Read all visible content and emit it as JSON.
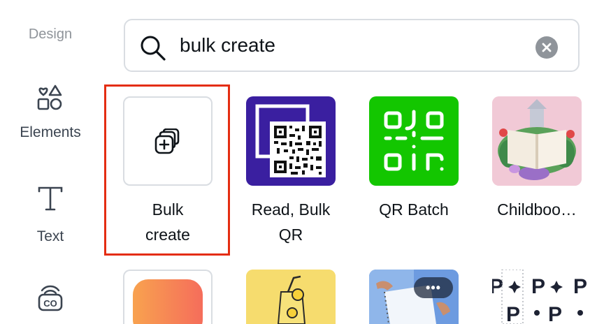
{
  "sidebar": {
    "items": [
      {
        "label": "Design",
        "icon": "design-icon"
      },
      {
        "label": "Elements",
        "icon": "elements-icon"
      },
      {
        "label": "Text",
        "icon": "text-icon"
      },
      {
        "label": "",
        "icon": "brand-icon",
        "badge": "CO"
      }
    ]
  },
  "search": {
    "value": "bulk create",
    "icon": "search-icon",
    "clear_icon": "close-icon"
  },
  "apps": [
    {
      "name": "Bulk create",
      "line1": "Bulk",
      "line2": "create",
      "icon": "bulk-create-icon"
    },
    {
      "name": "Read, Bulk QR",
      "line1": "Read, Bulk",
      "line2": "QR"
    },
    {
      "name": "QR Batch",
      "line1": "QR Batch"
    },
    {
      "name": "Childboo...",
      "line1": "Childboo…"
    }
  ],
  "more_button": {
    "label": "•••"
  },
  "colors": {
    "accent_red": "#e42d12",
    "qr_purple": "#3a1fa0",
    "qr_green": "#13c600",
    "pink": "#f1c9d6"
  }
}
